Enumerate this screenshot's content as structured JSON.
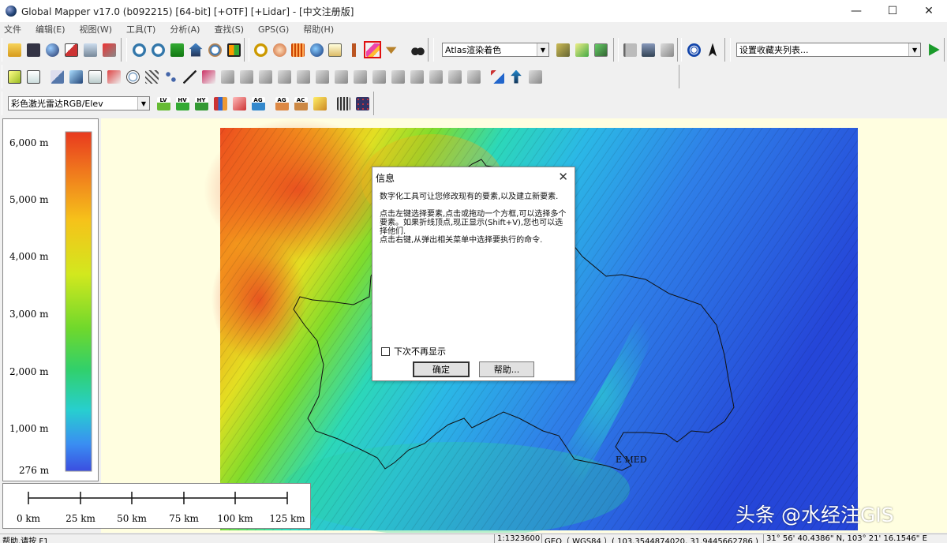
{
  "window": {
    "title": "Global Mapper v17.0 (b092215) [64-bit] [+OTF] [+Lidar] - [中文注册版]",
    "minimize_glyph": "—",
    "maximize_glyph": "☐",
    "close_glyph": "✕"
  },
  "menu": [
    "文件",
    "编辑(E)",
    "视图(W)",
    "工具(T)",
    "分析(A)",
    "查找(S)",
    "GPS(G)",
    "帮助(H)"
  ],
  "toolbar": {
    "shader_combo": "Atlas渲染着色",
    "favorites_combo": "设置收藏夹列表...",
    "lidar_combo": "彩色激光雷达RGB/Elev",
    "btn_lv": "LV",
    "btn_hv": "HV",
    "btn_hy": "HY",
    "btn_ag": "AG",
    "btn_ac": "AC"
  },
  "legend": {
    "labels": [
      "6,000 m",
      "5,000 m",
      "4,000 m",
      "3,000 m",
      "2,000 m",
      "1,000 m",
      "276 m"
    ]
  },
  "scale": {
    "labels": [
      "0 km",
      "25 km",
      "50 km",
      "75 km",
      "100 km",
      "125 km"
    ]
  },
  "map": {
    "place_label": "E MED"
  },
  "dialog": {
    "title": "信息",
    "close_glyph": "✕",
    "para1": "数字化工具可让您修改现有的要素,以及建立新要素.",
    "para2": "点击左键选择要素,点击或拖动一个方框,可以选择多个要素。如果折线顶点,现正显示(Shift+V),您也可以选择他们.",
    "para3": "点击右键,从弹出相关菜单中选择要执行的命令.",
    "checkbox_label": "下次不再显示",
    "ok_label": "确定",
    "help_label": "帮助..."
  },
  "status": {
    "help": "帮助,请按 F1",
    "scale": "1:1323600",
    "projection": "GEO（ WGS84 ）( 103.3544874020, 31.9445662786 )",
    "coords": "31° 56' 40.4386\" N, 103° 21' 16.1546\" E"
  },
  "watermark": "头条 @水经注GIS",
  "colors": {
    "ramp": [
      "#e8391f",
      "#f07a1d",
      "#f6c21a",
      "#d2e81e",
      "#6fd82c",
      "#31d06b",
      "#27cfcf",
      "#3a8ef2",
      "#3b4ee0"
    ],
    "selected_tool_border": "#e01010"
  }
}
